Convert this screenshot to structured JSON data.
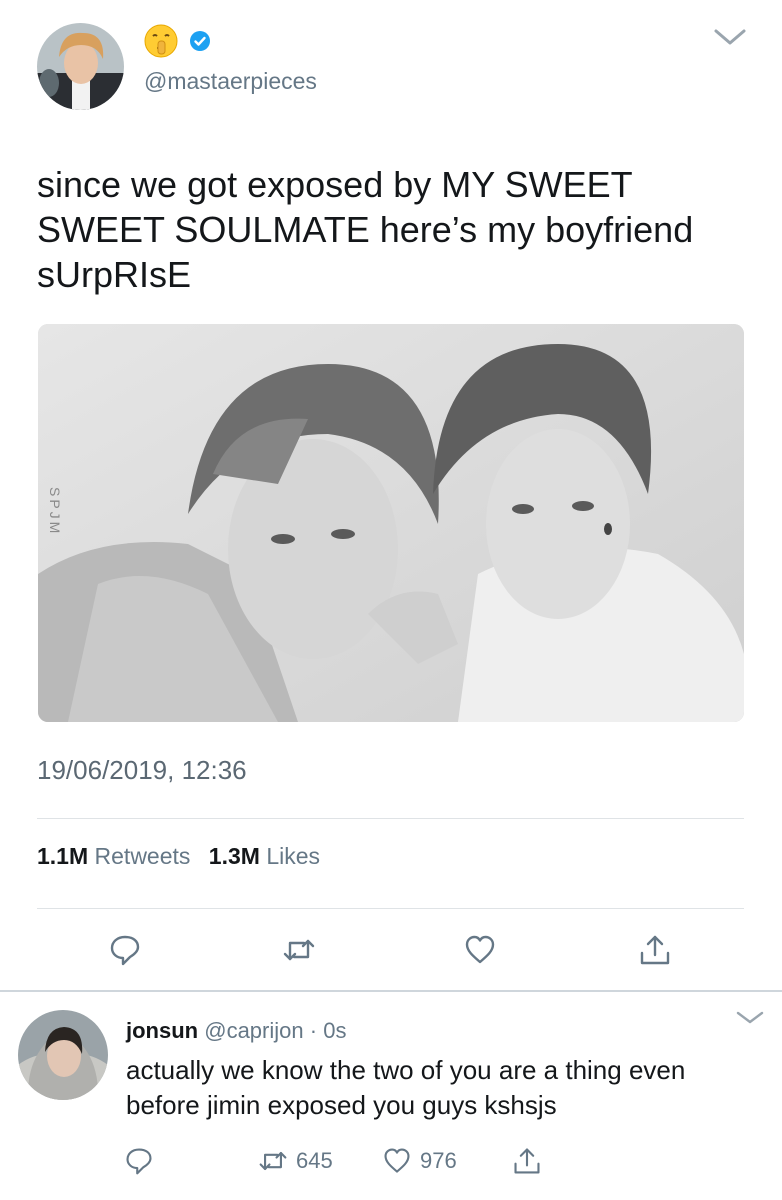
{
  "tweet": {
    "handle": "@mastaerpieces",
    "name_emoji": "shushing-face-emoji",
    "verified_icon": "verified-badge-icon",
    "text_lines": [
      "since we got exposed by MY SWEET",
      "SWEET SOULMATE here’s my boyfriend",
      "sUrpRIsE"
    ],
    "media_watermark": "SPJM",
    "timestamp": "19/06/2019, 12:36",
    "retweets_count": "1.1M",
    "retweets_label": "Retweets",
    "likes_count": "1.3M",
    "likes_label": "Likes",
    "actions": [
      "reply-icon",
      "retweet-icon",
      "like-icon",
      "share-icon"
    ]
  },
  "reply": {
    "name": "jonsun",
    "handle": "@caprijon",
    "separator": "·",
    "time": "0s",
    "text_lines": [
      "actually we know the two of you are a thing even",
      "before jimin exposed you guys kshsjs"
    ],
    "retweets": "645",
    "likes": "976"
  },
  "colors": {
    "text": "#14171a",
    "secondary": "#657786",
    "verified": "#1da1f2",
    "divider": "#dfe3e6"
  }
}
